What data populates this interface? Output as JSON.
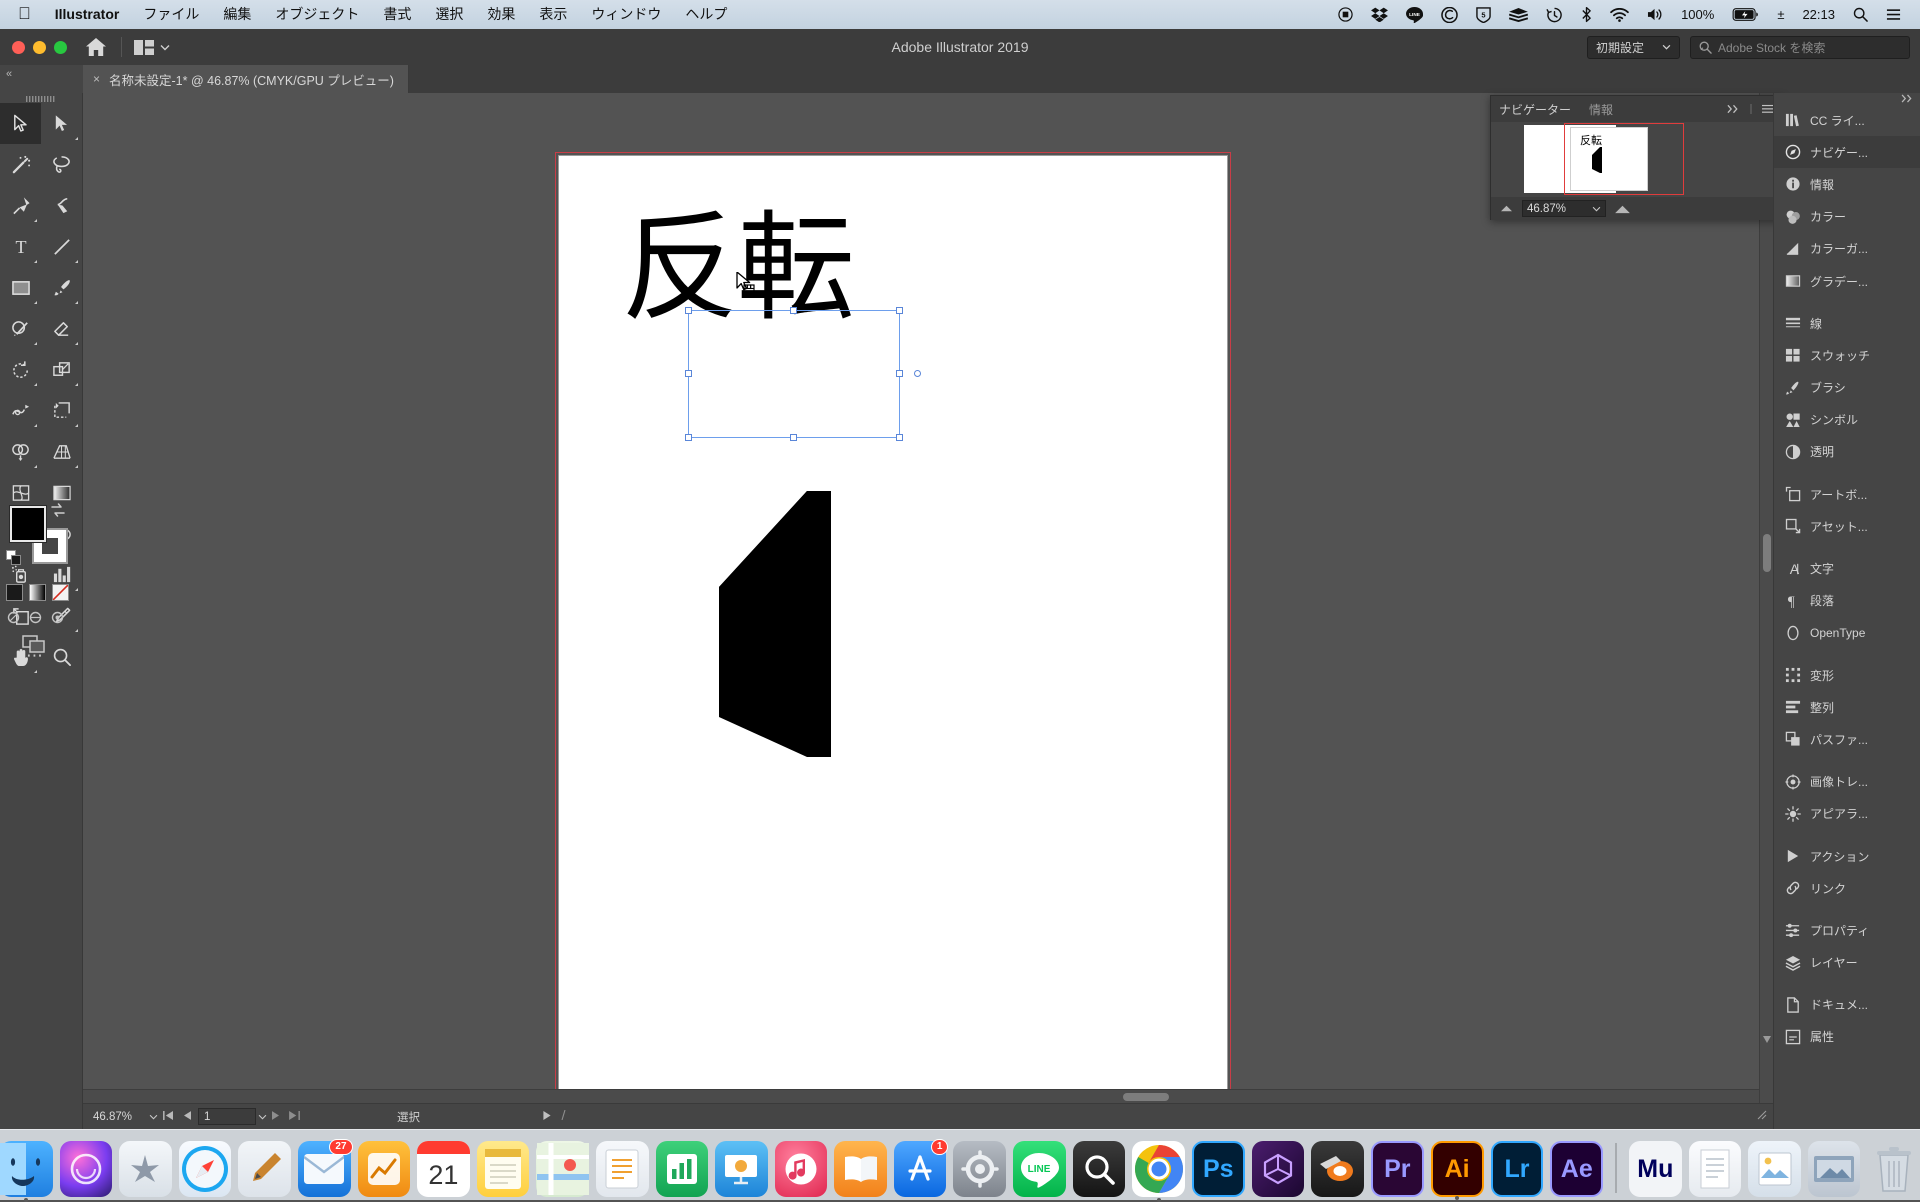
{
  "macbar": {
    "apple": "apple-logo",
    "app_name": "Illustrator",
    "menus": [
      "ファイル",
      "編集",
      "オブジェクト",
      "書式",
      "選択",
      "効果",
      "表示",
      "ウィンドウ",
      "ヘルプ"
    ],
    "tray_icons": [
      "record-icon",
      "dropbox-icon",
      "line-icon",
      "creative-cloud-icon",
      "five-shield-icon",
      "stack-icon",
      "time-machine-icon",
      "bluetooth-icon",
      "wifi-icon",
      "volume-icon"
    ],
    "battery_percent": "100%",
    "input_source": "±",
    "clock": "22:13",
    "search_icon": "search-icon",
    "notification_icon": "notification-center-icon"
  },
  "titlebar": {
    "title": "Adobe Illustrator 2019",
    "home_icon": "home-icon",
    "arrange_icon": "arrange-documents-icon",
    "workspace": "初期設定",
    "stock_placeholder": "Adobe Stock を検索"
  },
  "tabbar": {
    "collapse_label": "«",
    "tab_close": "×",
    "tab_title": "名称未設定-1* @ 46.87% (CMYK/GPU プレビュー)"
  },
  "toolbar": {
    "tools": [
      {
        "name": "selection-tool",
        "icon": "arrow-solid",
        "selected": true,
        "corner": false
      },
      {
        "name": "direct-selection-tool",
        "icon": "arrow-filled",
        "selected": false,
        "corner": true
      },
      {
        "name": "magic-wand-tool",
        "icon": "magic-wand",
        "selected": false,
        "corner": false
      },
      {
        "name": "lasso-tool",
        "icon": "lasso",
        "selected": false,
        "corner": false
      },
      {
        "name": "pen-tool",
        "icon": "pen",
        "selected": false,
        "corner": true
      },
      {
        "name": "curvature-tool",
        "icon": "curvature",
        "selected": false,
        "corner": false
      },
      {
        "name": "type-tool",
        "icon": "type-T",
        "selected": false,
        "corner": true
      },
      {
        "name": "line-segment-tool",
        "icon": "line",
        "selected": false,
        "corner": true
      },
      {
        "name": "rectangle-tool",
        "icon": "rectangle",
        "selected": false,
        "corner": true
      },
      {
        "name": "paintbrush-tool",
        "icon": "paintbrush",
        "selected": false,
        "corner": true
      },
      {
        "name": "shaper-tool",
        "icon": "shaper",
        "selected": false,
        "corner": true
      },
      {
        "name": "eraser-tool",
        "icon": "eraser",
        "selected": false,
        "corner": true
      },
      {
        "name": "rotate-tool",
        "icon": "rotate",
        "selected": false,
        "corner": true
      },
      {
        "name": "scale-tool",
        "icon": "scale",
        "selected": false,
        "corner": true
      },
      {
        "name": "width-tool",
        "icon": "width",
        "selected": false,
        "corner": true
      },
      {
        "name": "free-transform-tool",
        "icon": "free-transform",
        "selected": false,
        "corner": true
      },
      {
        "name": "shape-builder-tool",
        "icon": "shape-builder",
        "selected": false,
        "corner": true
      },
      {
        "name": "perspective-grid-tool",
        "icon": "perspective-grid",
        "selected": false,
        "corner": true
      },
      {
        "name": "mesh-tool",
        "icon": "mesh",
        "selected": false,
        "corner": false
      },
      {
        "name": "gradient-tool",
        "icon": "gradient",
        "selected": false,
        "corner": false
      },
      {
        "name": "eyedropper-tool",
        "icon": "eyedropper",
        "selected": false,
        "corner": true
      },
      {
        "name": "blend-tool",
        "icon": "blend",
        "selected": false,
        "corner": false
      },
      {
        "name": "symbol-sprayer-tool",
        "icon": "symbol-sprayer",
        "selected": false,
        "corner": true
      },
      {
        "name": "column-graph-tool",
        "icon": "column-graph",
        "selected": false,
        "corner": true
      },
      {
        "name": "artboard-tool",
        "icon": "artboard",
        "selected": false,
        "corner": false
      },
      {
        "name": "slice-tool",
        "icon": "slice",
        "selected": false,
        "corner": true
      },
      {
        "name": "hand-tool",
        "icon": "hand",
        "selected": false,
        "corner": true
      },
      {
        "name": "zoom-tool",
        "icon": "magnifier",
        "selected": false,
        "corner": false
      }
    ],
    "fill_color": "#000000",
    "stroke_color": "#ffffff",
    "swap_icon": "swap-fill-stroke-icon",
    "default_icon": "default-fill-stroke-icon",
    "mini_swatches": [
      "color-swatch-icon",
      "gradient-swatch-icon",
      "none-swatch-icon"
    ],
    "draw_modes": [
      "draw-normal-icon",
      "draw-behind-icon",
      "draw-inside-icon"
    ],
    "screen_mode_icon": "change-screen-mode-icon",
    "more_icon": "edit-toolbar-ellipsis"
  },
  "canvas": {
    "artboard_text": "反転",
    "glyph_label": "reversed-kanji-shape",
    "selection_cursor": "move-cursor-icon"
  },
  "navigator": {
    "tabs": [
      {
        "label": "ナビゲーター",
        "active": true
      },
      {
        "label": "情報",
        "active": false
      }
    ],
    "collapse_icon": "double-chevron-right-icon",
    "menu_icon": "panel-menu-icon",
    "thumb_text": "反転",
    "zoom_value": "46.87%",
    "zoom_out_icon": "zoom-out-small-icon",
    "zoom_in_icon": "zoom-in-large-icon",
    "dropdown_icon": "chevron-down-icon"
  },
  "dock": {
    "collapse_icon": "double-chevron-right-icon",
    "groups": [
      [
        {
          "label": "CC ライ...",
          "icon": "cc-libraries-icon",
          "active": false
        },
        {
          "label": "ナビゲー...",
          "icon": "navigator-icon",
          "active": true
        },
        {
          "label": "情報",
          "icon": "info-icon",
          "active": false
        },
        {
          "label": "カラー",
          "icon": "color-icon",
          "active": false
        },
        {
          "label": "カラーガ...",
          "icon": "color-guide-icon",
          "active": false
        },
        {
          "label": "グラデー...",
          "icon": "gradient-icon",
          "active": false
        }
      ],
      [
        {
          "label": "線",
          "icon": "stroke-icon",
          "active": false
        },
        {
          "label": "スウォッチ",
          "icon": "swatches-icon",
          "active": false
        },
        {
          "label": "ブラシ",
          "icon": "brushes-icon",
          "active": false
        },
        {
          "label": "シンボル",
          "icon": "symbols-icon",
          "active": false
        },
        {
          "label": "透明",
          "icon": "transparency-icon",
          "active": false
        }
      ],
      [
        {
          "label": "アートボ...",
          "icon": "artboards-icon",
          "active": false
        },
        {
          "label": "アセット...",
          "icon": "asset-export-icon",
          "active": false
        }
      ],
      [
        {
          "label": "文字",
          "icon": "character-icon",
          "active": false
        },
        {
          "label": "段落",
          "icon": "paragraph-icon",
          "active": false
        },
        {
          "label": "OpenType",
          "icon": "opentype-icon",
          "active": false
        }
      ],
      [
        {
          "label": "変形",
          "icon": "transform-icon",
          "active": false
        },
        {
          "label": "整列",
          "icon": "align-icon",
          "active": false
        },
        {
          "label": "パスファ...",
          "icon": "pathfinder-icon",
          "active": false
        }
      ],
      [
        {
          "label": "画像トレ...",
          "icon": "image-trace-icon",
          "active": false
        },
        {
          "label": "アピアラ...",
          "icon": "appearance-icon",
          "active": false
        }
      ],
      [
        {
          "label": "アクション",
          "icon": "actions-icon",
          "active": false
        },
        {
          "label": "リンク",
          "icon": "links-icon",
          "active": false
        }
      ],
      [
        {
          "label": "プロパティ",
          "icon": "properties-icon",
          "active": false
        },
        {
          "label": "レイヤー",
          "icon": "layers-icon",
          "active": false
        }
      ],
      [
        {
          "label": "ドキュメ...",
          "icon": "document-info-icon",
          "active": false
        },
        {
          "label": "属性",
          "icon": "attributes-icon",
          "active": false
        }
      ]
    ]
  },
  "statusbar": {
    "zoom": "46.87%",
    "zoom_dropdown_icon": "chevron-down-icon",
    "first_icon": "first-artboard-icon",
    "prev_icon": "previous-artboard-icon",
    "page": "1",
    "page_dropdown_icon": "chevron-down-icon",
    "next_icon": "next-artboard-icon",
    "last_icon": "last-artboard-icon",
    "status_text": "選択",
    "status_dropdown_icon": "triangle-right-icon",
    "resize_icon": "resize-grip-icon"
  },
  "macdock": {
    "items": [
      {
        "name": "finder",
        "label": "",
        "color": "#3aa0ff",
        "icon": "finder-icon",
        "running": true
      },
      {
        "name": "siri",
        "label": "",
        "color": "#7a4bd6",
        "icon": "siri-icon",
        "running": false
      },
      {
        "name": "launchpad",
        "label": "",
        "color": "#dfe3e8",
        "icon": "launchpad-icon",
        "running": false
      },
      {
        "name": "safari",
        "label": "",
        "color": "#f4f6f8",
        "icon": "safari-icon",
        "running": false
      },
      {
        "name": "notes-pen",
        "label": "",
        "color": "#e9edf1",
        "icon": "pen-app-icon",
        "running": false
      },
      {
        "name": "mail",
        "label": "",
        "color": "#2f8ae8",
        "icon": "mail-icon",
        "badge": "27",
        "running": false
      },
      {
        "name": "finance",
        "label": "",
        "color": "#f3a21a",
        "icon": "finance-icon",
        "running": false
      },
      {
        "name": "calendar",
        "label": "21",
        "color": "#ffffff",
        "icon": "calendar-icon",
        "running": false
      },
      {
        "name": "notes",
        "label": "",
        "color": "#ffd94d",
        "icon": "notes-icon",
        "running": false
      },
      {
        "name": "maps",
        "label": "",
        "color": "#e3f0da",
        "icon": "maps-icon",
        "running": false
      },
      {
        "name": "pages",
        "label": "",
        "color": "#f2f4f7",
        "icon": "pages-icon",
        "running": false
      },
      {
        "name": "numbers",
        "label": "",
        "color": "#1fa85a",
        "icon": "numbers-icon",
        "running": false
      },
      {
        "name": "keynote",
        "label": "",
        "color": "#2e9fe8",
        "icon": "keynote-icon",
        "running": false
      },
      {
        "name": "itunes",
        "label": "",
        "color": "#f24b6a",
        "icon": "itunes-icon",
        "running": false
      },
      {
        "name": "ibooks",
        "label": "",
        "color": "#ff9b2f",
        "icon": "ibooks-icon",
        "running": false
      },
      {
        "name": "appstore",
        "label": "",
        "color": "#1f8df5",
        "icon": "appstore-icon",
        "badge": "1",
        "running": false
      },
      {
        "name": "system-preferences",
        "label": "",
        "color": "#8e9199",
        "icon": "gear-icon",
        "running": false
      },
      {
        "name": "line",
        "label": "",
        "color": "#06c755",
        "icon": "line-app-icon",
        "running": false
      },
      {
        "name": "quicklook",
        "label": "",
        "color": "#2b2b2b",
        "icon": "quicklook-icon",
        "running": false
      },
      {
        "name": "chrome",
        "label": "",
        "color": "#ffffff",
        "icon": "chrome-icon",
        "running": true
      },
      {
        "name": "photoshop",
        "label": "Ps",
        "color": "#001e36",
        "icon": "photoshop-icon",
        "running": false
      },
      {
        "name": "dimension",
        "label": "",
        "color": "#2a0a3c",
        "icon": "dimension-icon",
        "running": false
      },
      {
        "name": "blender",
        "label": "",
        "color": "#2b2b2b",
        "icon": "blender-icon",
        "running": false
      },
      {
        "name": "premiere",
        "label": "Pr",
        "color": "#2a0634",
        "icon": "premiere-icon",
        "running": false
      },
      {
        "name": "illustrator",
        "label": "Ai",
        "color": "#330000",
        "icon": "illustrator-icon",
        "running": true
      },
      {
        "name": "lightroom",
        "label": "Lr",
        "color": "#001e36",
        "icon": "lightroom-icon",
        "running": false
      },
      {
        "name": "aftereffects",
        "label": "Ae",
        "color": "#1d0033",
        "icon": "aftereffects-icon",
        "running": false
      },
      {
        "name": "muse",
        "label": "Mu",
        "color": "#f2f4f7",
        "icon": "muse-icon",
        "running": false
      },
      {
        "name": "notepad",
        "label": "",
        "color": "#f0f2f5",
        "icon": "notepad-icon",
        "running": false
      },
      {
        "name": "preview",
        "label": "",
        "color": "#e7edf3",
        "icon": "preview-icon",
        "running": false
      },
      {
        "name": "downloads",
        "label": "",
        "color": "#cfd6de",
        "icon": "downloads-stack-icon",
        "running": false
      },
      {
        "name": "trash",
        "label": "",
        "color": "#d8dde3",
        "icon": "trash-icon",
        "running": false
      }
    ]
  }
}
